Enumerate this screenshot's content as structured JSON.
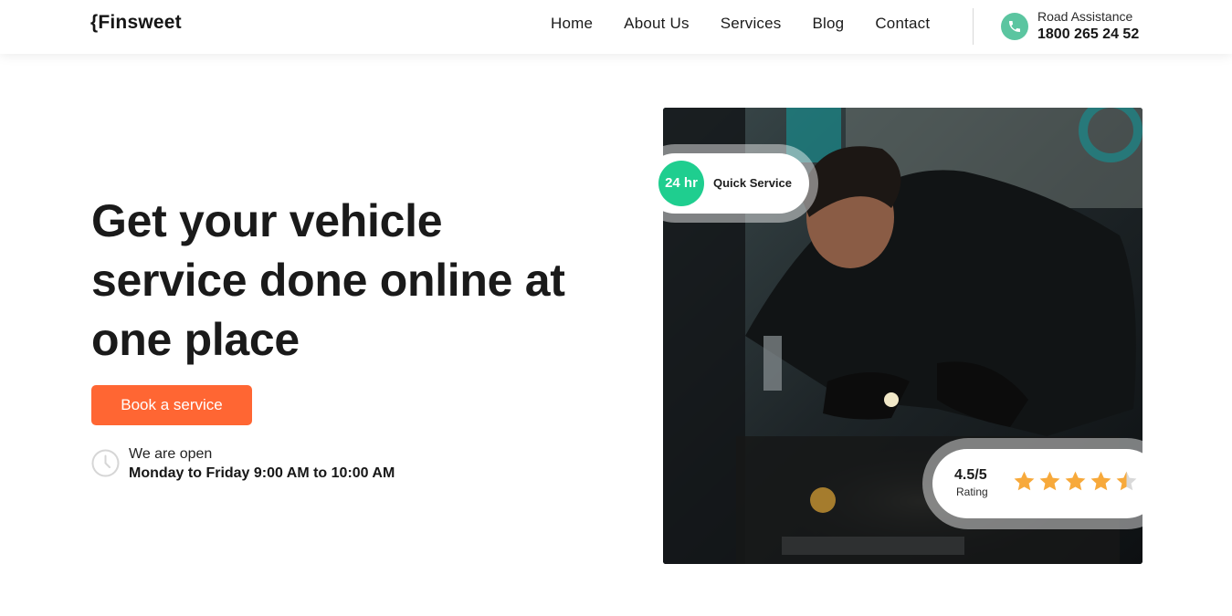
{
  "header": {
    "logo": "{Finsweet",
    "nav": [
      "Home",
      "About Us",
      "Services",
      "Blog",
      "Contact"
    ],
    "road_assistance_label": "Road Assistance",
    "road_assistance_number": "1800 265 24 52"
  },
  "hero": {
    "title": "Get your vehicle service done online at one place",
    "button": "Book a service",
    "open_label": "We are open",
    "open_hours": "Monday to Friday 9:00 AM to 10:00 AM"
  },
  "badge": {
    "hours": "24 hr",
    "text": "Quick Service"
  },
  "rating": {
    "score": "4.5/5",
    "label": "Rating",
    "stars": 4.5
  },
  "colors": {
    "accent": "#ff6633",
    "badge_green": "#1fce8f",
    "phone_green": "#5bc5a0",
    "star": "#f7a93b"
  },
  "icons": [
    "phone-icon",
    "clock-icon",
    "star-icon"
  ]
}
